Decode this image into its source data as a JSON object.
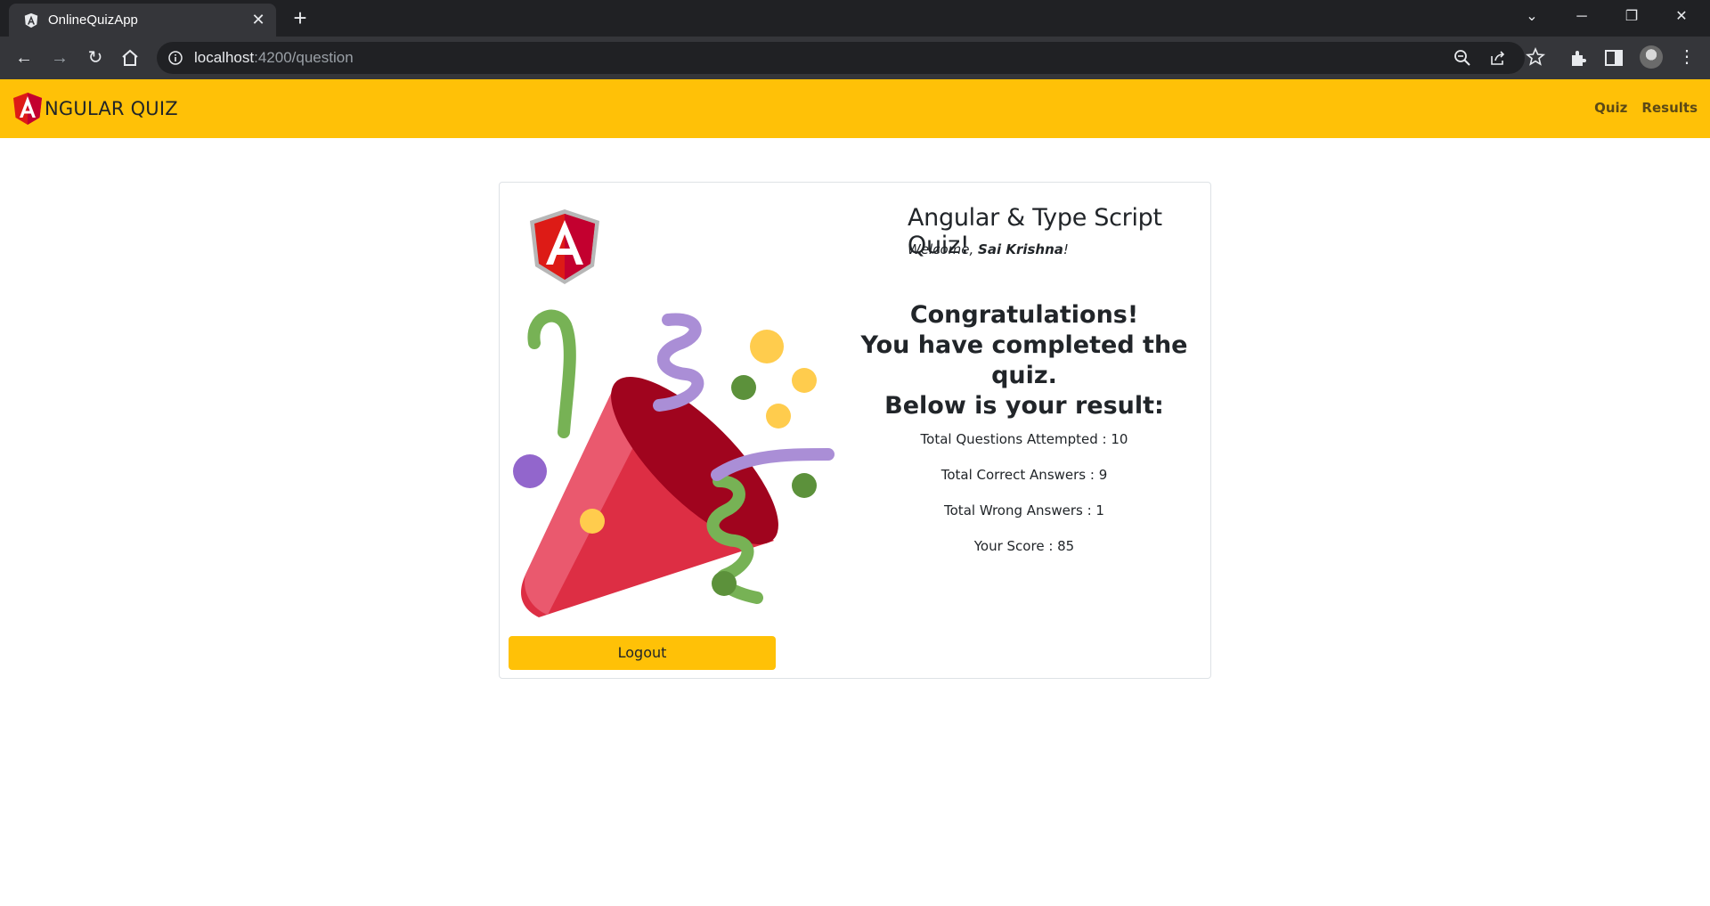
{
  "browser": {
    "tab_title": "OnlineQuizApp",
    "url_host": "localhost",
    "url_path": ":4200/question"
  },
  "navbar": {
    "brand_text": "NGULAR QUIZ",
    "links": [
      "Quiz",
      "Results"
    ],
    "color": "#ffc107"
  },
  "card": {
    "title": "Angular & Type Script Quiz!",
    "welcome_prefix": "Welcome, ",
    "user_name": "Sai Krishna",
    "welcome_suffix": "!",
    "congrats_lines": [
      "Congratulations!",
      "You have completed the quiz.",
      "Below is your result:"
    ],
    "stats": [
      "Total Questions Attempted : 10",
      "Total Correct Answers : 9",
      "Total Wrong Answers : 1",
      "Your Score : 85"
    ],
    "logout_label": "Logout"
  }
}
